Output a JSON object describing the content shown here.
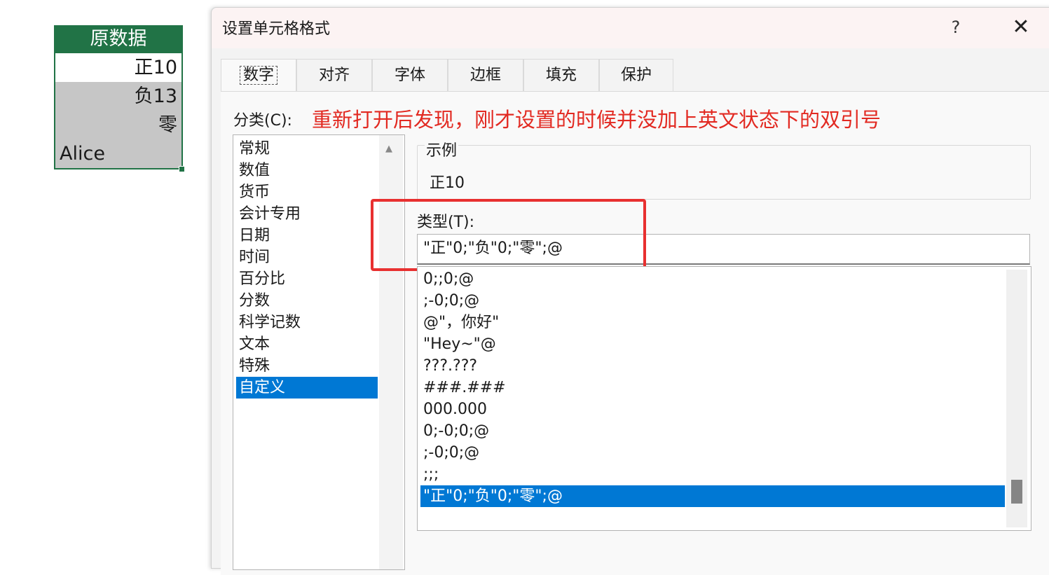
{
  "sheet": {
    "header": "原数据",
    "cells": [
      "正10",
      "负13",
      "零",
      "Alice"
    ]
  },
  "dialog": {
    "title": "设置单元格格式",
    "help": "?",
    "close": "✕",
    "tabs": [
      "数字",
      "对齐",
      "字体",
      "边框",
      "填充",
      "保护"
    ],
    "category_label": "分类(C):",
    "annotation": "重新打开后发现，刚才设置的时候并没加上英文状态下的双引号",
    "categories": [
      "常规",
      "数值",
      "货币",
      "会计专用",
      "日期",
      "时间",
      "百分比",
      "分数",
      "科学记数",
      "文本",
      "特殊",
      "自定义"
    ],
    "selected_category": "自定义",
    "sample_label": "示例",
    "sample_value": "正10",
    "type_label": "类型(T):",
    "type_value": "\"正\"0;\"负\"0;\"零\";@",
    "formats": [
      "0;;0;@",
      ";-0;0;@",
      "@\"，你好\"",
      "\"Hey~\"@",
      "???.???",
      "###.###",
      "000.000",
      "0;-0;0;@",
      ";-0;0;@",
      ";;;",
      "\"正\"0;\"负\"0;\"零\";@"
    ],
    "selected_format": "\"正\"0;\"负\"0;\"零\";@"
  },
  "colors": {
    "excel_green": "#217346",
    "selection_blue": "#0078d4",
    "annotation_red": "#e22a22"
  }
}
